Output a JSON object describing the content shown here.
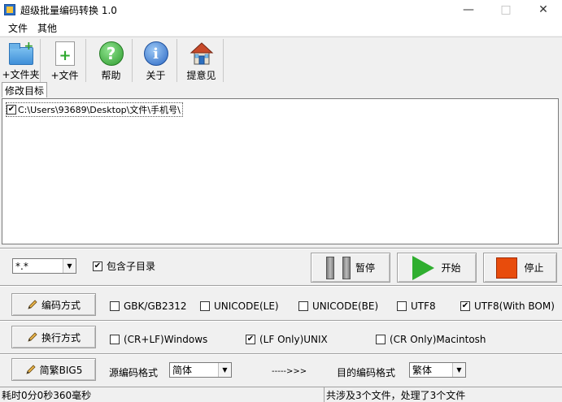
{
  "window": {
    "title": "超级批量编码转换 1.0"
  },
  "menu": [
    "文件",
    "其他"
  ],
  "toolbar": {
    "add_folder": "+文件夹",
    "add_file": "+文件",
    "help": "帮助",
    "about": "关于",
    "feedback": "提意见"
  },
  "tab": {
    "label": "修改目标"
  },
  "targets": [
    {
      "path": "C:\\Users\\93689\\Desktop\\文件\\手机号\\",
      "checked": true
    }
  ],
  "filter": {
    "pattern": "*.*",
    "include_subdirs_label": "包含子目录",
    "include_subdirs": true
  },
  "actions": {
    "pause": "暂停",
    "start": "开始",
    "stop": "停止"
  },
  "encoding": {
    "button": "编码方式",
    "options": [
      {
        "label": "GBK/GB2312",
        "checked": false
      },
      {
        "label": "UNICODE(LE)",
        "checked": false
      },
      {
        "label": "UNICODE(BE)",
        "checked": false
      },
      {
        "label": "UTF8",
        "checked": false
      },
      {
        "label": "UTF8(With BOM)",
        "checked": true
      }
    ]
  },
  "linebreak": {
    "button": "换行方式",
    "options": [
      {
        "label": "(CR+LF)Windows",
        "checked": false
      },
      {
        "label": "(LF Only)UNIX",
        "checked": true
      },
      {
        "label": "(CR Only)Macintosh",
        "checked": false
      }
    ]
  },
  "chinese": {
    "button": "简繁BIG5",
    "source_label": "源编码格式",
    "source_value": "简体",
    "arrow": "----->>>",
    "target_label": "目的编码格式",
    "target_value": "繁体"
  },
  "status": {
    "elapsed": "耗时0分0秒360毫秒",
    "summary": "共涉及3个文件，处理了3个文件"
  },
  "icons": {
    "add_folder": "folder-add-icon",
    "add_file": "file-add-icon",
    "help": "help-icon",
    "about": "info-icon",
    "feedback": "home-icon",
    "option_buttons": "pencil-icon"
  }
}
